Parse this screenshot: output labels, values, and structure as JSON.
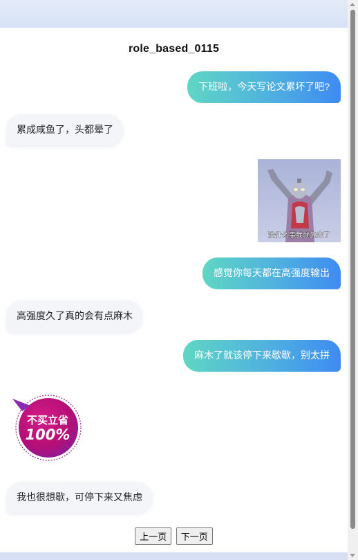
{
  "chat": {
    "title": "role_based_0115",
    "messages": [
      {
        "side": "right",
        "text": "下班啦，今天写论文累坏了吧?"
      },
      {
        "side": "left",
        "text": "累成咸鱼了，头都晕了"
      },
      {
        "side": "right",
        "sticker": "ultraman-sticker",
        "caption": "没什么事我就先走了"
      },
      {
        "side": "right",
        "text": "感觉你每天都在高强度输出"
      },
      {
        "side": "left",
        "text": "高强度久了真的会有点麻木"
      },
      {
        "side": "right",
        "text": "麻木了就该停下来歇歇，别太拼"
      },
      {
        "side": "left",
        "sticker": "badge-sticker",
        "line1": "不买立省",
        "line2": "100%"
      },
      {
        "side": "left",
        "text": "我也很想歇，可停下来又焦虑"
      }
    ]
  },
  "pager": {
    "prev_label": "上一页",
    "next_label": "下一页"
  },
  "colors": {
    "bubble_right_start": "#5fd6c4",
    "bubble_right_end": "#3e8bf2",
    "bubble_left": "#f3f5f9",
    "badge": "#c4127e"
  }
}
